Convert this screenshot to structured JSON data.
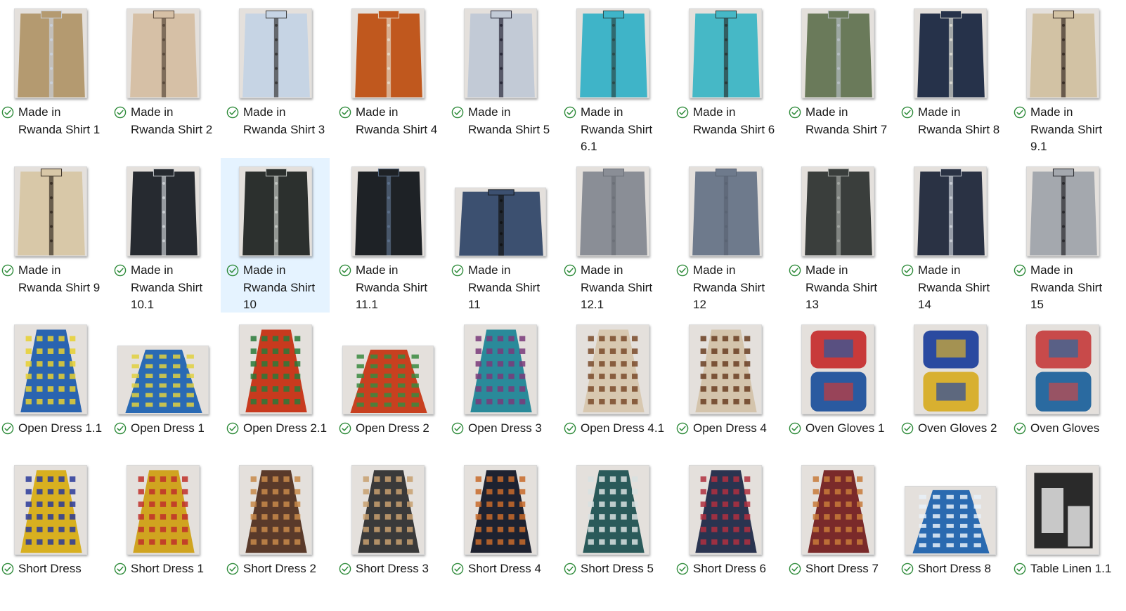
{
  "items": [
    {
      "label": "Made in Rwanda Shirt 1",
      "thumb": "shirt",
      "colors": [
        "#b49a70",
        "#c9cfd8"
      ],
      "shape": "portrait"
    },
    {
      "label": "Made in Rwanda Shirt 2",
      "thumb": "shirt",
      "colors": [
        "#d6c0a6",
        "#5a4a3c"
      ],
      "shape": "portrait"
    },
    {
      "label": "Made in Rwanda Shirt 3",
      "thumb": "shirt",
      "colors": [
        "#c6d4e4",
        "#3a3a3a"
      ],
      "shape": "portrait"
    },
    {
      "label": "Made in Rwanda Shirt 4",
      "thumb": "shirt",
      "colors": [
        "#c0581e",
        "#e4d4c0"
      ],
      "shape": "portrait"
    },
    {
      "label": "Made in Rwanda Shirt 5",
      "thumb": "shirt",
      "colors": [
        "#c2cad6",
        "#2a2a3a"
      ],
      "shape": "portrait"
    },
    {
      "label": "Made in Rwanda Shirt 6.1",
      "thumb": "shirt",
      "colors": [
        "#3fb4c8",
        "#2b4a4a"
      ],
      "shape": "portrait"
    },
    {
      "label": "Made in Rwanda Shirt 6",
      "thumb": "shirt",
      "colors": [
        "#46b8c6",
        "#2a3838"
      ],
      "shape": "portrait"
    },
    {
      "label": "Made in Rwanda Shirt 7",
      "thumb": "shirt",
      "colors": [
        "#6a7a5a",
        "#b4bcc0"
      ],
      "shape": "portrait"
    },
    {
      "label": "Made in Rwanda Shirt 8",
      "thumb": "shirt",
      "colors": [
        "#26324a",
        "#d8d8d0"
      ],
      "shape": "portrait"
    },
    {
      "label": "Made in Rwanda Shirt 9.1",
      "thumb": "shirt",
      "colors": [
        "#d2c2a4",
        "#3a2e26"
      ],
      "shape": "portrait"
    },
    {
      "label": "Made in Rwanda Shirt 9",
      "thumb": "shirt",
      "colors": [
        "#d8c8a8",
        "#3a3026"
      ],
      "shape": "portrait"
    },
    {
      "label": "Made in Rwanda Shirt 10.1",
      "thumb": "shirt",
      "colors": [
        "#262a30",
        "#c8ccd0"
      ],
      "shape": "portrait"
    },
    {
      "label": "Made in Rwanda Shirt 10",
      "thumb": "shirt",
      "colors": [
        "#2c302e",
        "#c0c4c0"
      ],
      "shape": "portrait",
      "selected": true
    },
    {
      "label": "Made in Rwanda Shirt 11.1",
      "thumb": "shirt",
      "colors": [
        "#1e2226",
        "#5a6e88"
      ],
      "shape": "portrait"
    },
    {
      "label": "Made in Rwanda Shirt 11",
      "thumb": "shirt",
      "colors": [
        "#3c5070",
        "#121416"
      ],
      "shape": "landscape"
    },
    {
      "label": "Made in Rwanda Shirt 12.1",
      "thumb": "shirt",
      "colors": [
        "#8a8e96",
        "#6c7078"
      ],
      "shape": "portrait"
    },
    {
      "label": "Made in Rwanda Shirt 12",
      "thumb": "shirt",
      "colors": [
        "#6e7a8c",
        "#5a6474"
      ],
      "shape": "portrait"
    },
    {
      "label": "Made in Rwanda Shirt 13",
      "thumb": "shirt",
      "colors": [
        "#3a3e3c",
        "#a0a4a0"
      ],
      "shape": "portrait"
    },
    {
      "label": "Made in Rwanda Shirt 14",
      "thumb": "shirt",
      "colors": [
        "#2a3244",
        "#c8ccd4"
      ],
      "shape": "portrait"
    },
    {
      "label": "Made in Rwanda Shirt 15",
      "thumb": "shirt",
      "colors": [
        "#a4a8ae",
        "#2a2a2e"
      ],
      "shape": "portrait"
    },
    {
      "label": "Open Dress 1.1",
      "thumb": "dress",
      "colors": [
        "#2a64b0",
        "#e8d030"
      ],
      "shape": "portrait"
    },
    {
      "label": "Open Dress 1",
      "thumb": "dress",
      "colors": [
        "#2a6ab4",
        "#e0d040"
      ],
      "shape": "landscape"
    },
    {
      "label": "Open Dress 2.1",
      "thumb": "dress",
      "colors": [
        "#c83a1e",
        "#2a7a3a"
      ],
      "shape": "portrait"
    },
    {
      "label": "Open Dress 2",
      "thumb": "dress",
      "colors": [
        "#c84020",
        "#3a8a40"
      ],
      "shape": "landscape"
    },
    {
      "label": "Open Dress 3",
      "thumb": "dress",
      "colors": [
        "#2a8a9a",
        "#7a3a7a"
      ],
      "shape": "portrait"
    },
    {
      "label": "Open Dress 4.1",
      "thumb": "dress",
      "colors": [
        "#d8c8b0",
        "#7a4a2a"
      ],
      "shape": "portrait"
    },
    {
      "label": "Open Dress 4",
      "thumb": "dress",
      "colors": [
        "#d4c4ac",
        "#6a3e22"
      ],
      "shape": "portrait"
    },
    {
      "label": "Oven Gloves 1",
      "thumb": "gloves",
      "colors": [
        "#c83a3a",
        "#2a5aa0"
      ],
      "shape": "portrait"
    },
    {
      "label": "Oven Gloves 2",
      "thumb": "gloves",
      "colors": [
        "#2a4aa0",
        "#d8b030"
      ],
      "shape": "portrait"
    },
    {
      "label": "Oven Gloves",
      "thumb": "gloves",
      "colors": [
        "#c84a4a",
        "#2a6aa0"
      ],
      "shape": "portrait"
    },
    {
      "label": "Short Dress",
      "thumb": "dress",
      "colors": [
        "#d8b020",
        "#2a3a9a"
      ],
      "shape": "portrait"
    },
    {
      "label": "Short Dress 1",
      "thumb": "dress",
      "colors": [
        "#d0a420",
        "#c0302a"
      ],
      "shape": "portrait"
    },
    {
      "label": "Short Dress 2",
      "thumb": "dress",
      "colors": [
        "#5a3a2a",
        "#c88a4a"
      ],
      "shape": "portrait"
    },
    {
      "label": "Short Dress 3",
      "thumb": "dress",
      "colors": [
        "#3a3a3a",
        "#c8a070"
      ],
      "shape": "portrait"
    },
    {
      "label": "Short Dress 4",
      "thumb": "dress",
      "colors": [
        "#1e2230",
        "#c86a2a"
      ],
      "shape": "portrait"
    },
    {
      "label": "Short Dress 5",
      "thumb": "dress",
      "colors": [
        "#2a5a5a",
        "#d8e0e0"
      ],
      "shape": "portrait"
    },
    {
      "label": "Short Dress 6",
      "thumb": "dress",
      "colors": [
        "#2a3450",
        "#b03040"
      ],
      "shape": "portrait"
    },
    {
      "label": "Short Dress 7",
      "thumb": "dress",
      "colors": [
        "#7a2a2a",
        "#c87a3a"
      ],
      "shape": "portrait"
    },
    {
      "label": "Short Dress 8",
      "thumb": "dress",
      "colors": [
        "#2a6ab0",
        "#e8f0f8"
      ],
      "shape": "landscape"
    },
    {
      "label": "Table Linen 1.1",
      "thumb": "linen",
      "colors": [
        "#2a2a2a",
        "#c8c8c8"
      ],
      "shape": "portrait"
    }
  ],
  "colors": {
    "check": "#2e8b3a",
    "selected_bg": "#e5f3ff"
  },
  "icons": {
    "status": "sync-ok-check-icon"
  }
}
